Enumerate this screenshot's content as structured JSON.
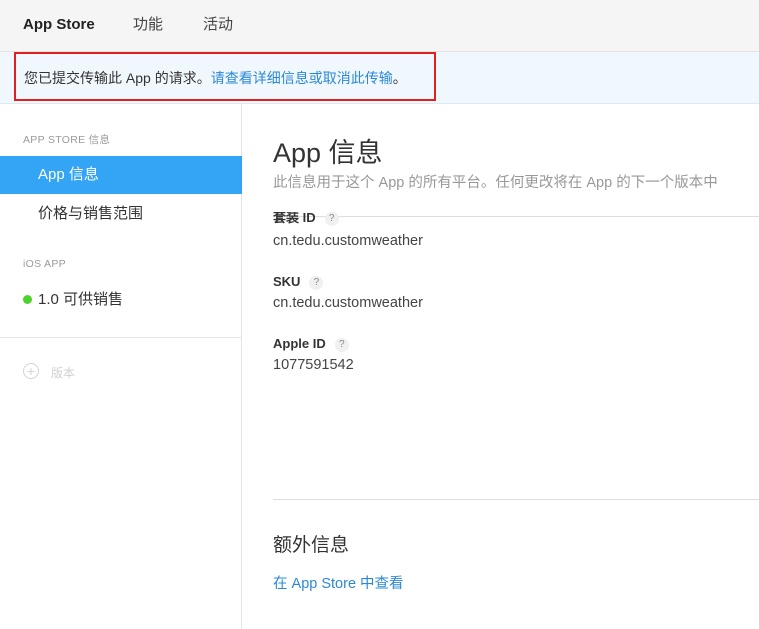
{
  "topnav": {
    "brand": "App Store",
    "tabs": [
      "功能",
      "活动"
    ]
  },
  "notice": {
    "text": "您已提交传输此 App 的请求。",
    "link": "请查看详细信息或取消此传输",
    "suffix": "。"
  },
  "sidebar": {
    "section1": "APP STORE 信息",
    "items": [
      "App 信息",
      "价格与销售范围"
    ],
    "section2": "iOS APP",
    "version": "1.0 可供销售",
    "add_version": "版本",
    "status_color": "#4ed32d",
    "active_color": "#34a4f4"
  },
  "main": {
    "title": "App 信息",
    "subtitle": "此信息用于这个 App 的所有平台。任何更改将在 App 的下一个版本中",
    "bundle_label": "套装 ID",
    "bundle_value": "cn.tedu.customweather",
    "sku_label": "SKU",
    "sku_value": "cn.tedu.customweather",
    "appleid_label": "Apple ID",
    "appleid_value": "1077591542",
    "help_glyph": "?",
    "extra_title": "额外信息",
    "store_link": "在 App Store 中查看"
  }
}
